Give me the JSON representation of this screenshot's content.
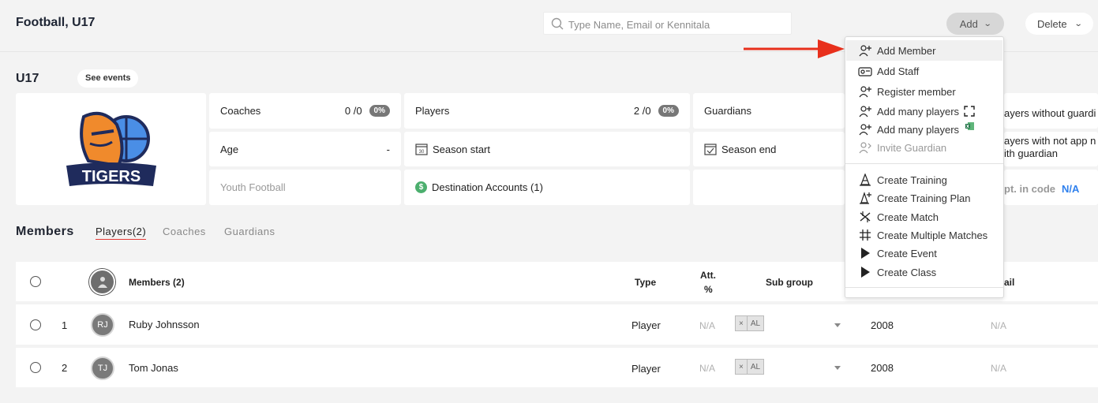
{
  "header": {
    "title": "Football, U17",
    "search_placeholder": "Type Name, Email or Kennitala",
    "add_label": "Add",
    "delete_label": "Delete"
  },
  "group": {
    "name": "U17",
    "see_events_label": "See events",
    "logo_text": "TIGERS",
    "coaches_label": "Coaches",
    "coaches_value": "0 /0",
    "coaches_badge": "0%",
    "players_label": "Players",
    "players_value": "2 /0",
    "players_badge": "0%",
    "guardians_label": "Guardians",
    "age_label": "Age",
    "age_value": "-",
    "season_start_label": "Season start",
    "season_end_label": "Season end",
    "sport_label": "Youth Football",
    "destination_accounts_label": "Destination Accounts (1)",
    "players_without_guardian": "ayers without guardi",
    "players_not_app_line1": "ayers with not app n",
    "players_not_app_line2": "ith guardian",
    "dept_code_label": "pt. in code",
    "dept_code_value": "N/A"
  },
  "members": {
    "title": "Members",
    "tabs": [
      "Players(2)",
      "Coaches",
      "Guardians"
    ],
    "columns": {
      "members": "Members (2)",
      "type": "Type",
      "att_line1": "Att.",
      "att_line2": "%",
      "subgroup": "Sub group",
      "email_partial": "ail"
    },
    "rows": [
      {
        "index": "1",
        "initials": "RJ",
        "name": "Ruby Johnsson",
        "type": "Player",
        "att": "N/A",
        "tag_x": "×",
        "tag": "AL",
        "year": "2008",
        "email": "N/A"
      },
      {
        "index": "2",
        "initials": "TJ",
        "name": "Tom Jonas",
        "type": "Player",
        "att": "N/A",
        "tag_x": "×",
        "tag": "AL",
        "year": "2008",
        "email": "N/A"
      }
    ]
  },
  "add_menu": {
    "items": [
      {
        "label": "Add Member",
        "icon": "person-add-icon"
      },
      {
        "label": "Add Staff",
        "icon": "id-card-icon"
      },
      {
        "label": "Register member",
        "icon": "person-add-icon"
      },
      {
        "label": "Add many players",
        "icon": "person-add-icon",
        "suffix_icon": "scan-icon"
      },
      {
        "label": "Add many players",
        "icon": "person-add-icon",
        "suffix_icon": "excel-icon"
      },
      {
        "label": "Invite Guardian",
        "icon": "person-invite-icon"
      },
      {
        "label": "Create Training",
        "icon": "cone-icon"
      },
      {
        "label": "Create Training Plan",
        "icon": "cone-plus-icon"
      },
      {
        "label": "Create Match",
        "icon": "match-icon"
      },
      {
        "label": "Create Multiple Matches",
        "icon": "multi-match-icon"
      },
      {
        "label": "Create Event",
        "icon": "play-icon"
      },
      {
        "label": "Create Class",
        "icon": "play-icon"
      }
    ]
  },
  "colors": {
    "accent_blue": "#2f80ed",
    "arrow_red": "#e8301c",
    "tab_underline": "#e53935",
    "logo_navy": "#1f2b5c",
    "logo_orange": "#f08a2c",
    "logo_blue": "#4a8ee6"
  }
}
